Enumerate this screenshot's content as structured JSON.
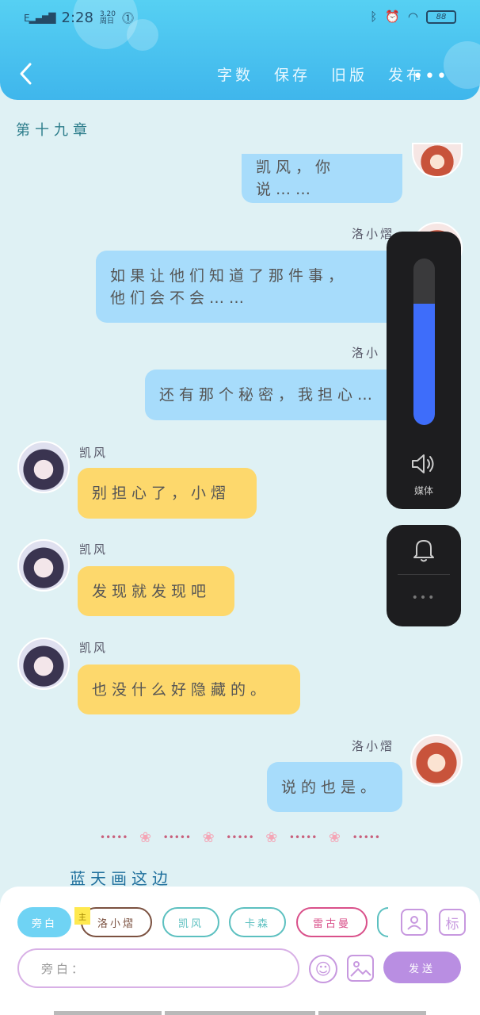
{
  "status_bar": {
    "signal": "E",
    "time": "2:28",
    "date": "3.20",
    "date_sub": "周日",
    "battery": "88"
  },
  "header": {
    "back_icon": "chevron-left-icon",
    "actions": [
      "字数",
      "保存",
      "旧版",
      "发布"
    ],
    "more": "•••"
  },
  "chapter_title": "第十九章",
  "messages": [
    {
      "side": "right",
      "speaker": "",
      "text": "凯风，你说……",
      "color": "blue"
    },
    {
      "side": "right",
      "speaker": "洛小熠",
      "text": "如果让他们知道了那件事，他们会不会……",
      "line1": "如果让他们知道了那件事，",
      "line2": "他们会不会……",
      "color": "blue"
    },
    {
      "side": "right",
      "speaker": "洛小",
      "text": "还有那个秘密，我担心…",
      "color": "blue"
    },
    {
      "side": "left",
      "speaker": "凯风",
      "text": "别担心了，小熠",
      "color": "yellow"
    },
    {
      "side": "left",
      "speaker": "凯风",
      "text": "发现就发现吧",
      "color": "yellow"
    },
    {
      "side": "left",
      "speaker": "凯风",
      "text": "也没什么好隐藏的。",
      "color": "yellow"
    },
    {
      "side": "right",
      "speaker": "洛小熠",
      "text": "说的也是。",
      "color": "blue"
    }
  ],
  "volume_panel": {
    "level": 0.73,
    "label": "媒体",
    "accent": "#3e6dfa",
    "more": "•••"
  },
  "divider": {
    "flower": "❀",
    "dots": "•••••"
  },
  "author": "蓝天画这边",
  "composer": {
    "chips": [
      {
        "label": "旁白",
        "active": true,
        "border": "#6fd3f4",
        "color": "#ffffff"
      },
      {
        "label": "洛小熠",
        "active": false,
        "border": "#7b5140",
        "color": "#7b5140"
      },
      {
        "label": "凯风",
        "active": false,
        "border": "#5cc0c0",
        "color": "#5cc0c0"
      },
      {
        "label": "卡森",
        "active": false,
        "border": "#5cc0c0",
        "color": "#5cc0c0"
      },
      {
        "label": "雷古曼",
        "active": false,
        "border": "#d9508a",
        "color": "#d9508a"
      }
    ],
    "main_badge": "主",
    "tag_button": "标",
    "input_placeholder": "旁白：",
    "send": "发送",
    "accent": "#b98ee2"
  }
}
